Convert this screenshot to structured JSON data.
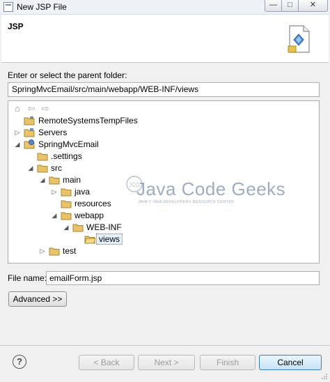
{
  "window": {
    "title": "New JSP File",
    "controls": {
      "minimize": "—",
      "maximize": "□",
      "close": "✕"
    }
  },
  "header": {
    "title": "JSP",
    "icon": "jsp-file-wizard-icon"
  },
  "parent_folder": {
    "label": "Enter or select the parent folder:",
    "value": "SpringMvcEmail/src/main/webapp/WEB-INF/views"
  },
  "tree": {
    "toolbar": {
      "home": "⌂",
      "back": "⇦",
      "forward": "⇨"
    },
    "items": [
      {
        "label": "RemoteSystemsTempFiles",
        "icon": "project-folder-icon",
        "twisty": ""
      },
      {
        "label": "Servers",
        "icon": "project-folder-icon",
        "twisty": "▷"
      },
      {
        "label": "SpringMvcEmail",
        "icon": "web-project-icon",
        "twisty": "◢"
      },
      {
        "label": ".settings",
        "icon": "folder-icon",
        "twisty": ""
      },
      {
        "label": "src",
        "icon": "folder-icon",
        "twisty": "◢"
      },
      {
        "label": "main",
        "icon": "folder-icon",
        "twisty": "◢"
      },
      {
        "label": "java",
        "icon": "folder-icon",
        "twisty": "▷"
      },
      {
        "label": "resources",
        "icon": "folder-icon",
        "twisty": ""
      },
      {
        "label": "webapp",
        "icon": "folder-icon",
        "twisty": "◢"
      },
      {
        "label": "WEB-INF",
        "icon": "folder-icon",
        "twisty": "◢"
      },
      {
        "label": "views",
        "icon": "folder-icon",
        "twisty": "",
        "selected": true
      },
      {
        "label": "test",
        "icon": "folder-icon",
        "twisty": "▷"
      }
    ]
  },
  "watermark": {
    "title": "Java Code Geeks",
    "subtitle": "JAVA 2 JAVA DEVELOPERS RESOURCE CENTER",
    "logo": "JCG"
  },
  "file_name": {
    "label": "File name:",
    "value": "emailForm.jsp"
  },
  "buttons": {
    "advanced": "Advanced >>",
    "help": "?",
    "back": "< Back",
    "next": "Next >",
    "finish": "Finish",
    "cancel": "Cancel"
  },
  "colors": {
    "folder": "#e8c36a",
    "selection": "#e5effa",
    "accent": "#3c7fb1"
  }
}
